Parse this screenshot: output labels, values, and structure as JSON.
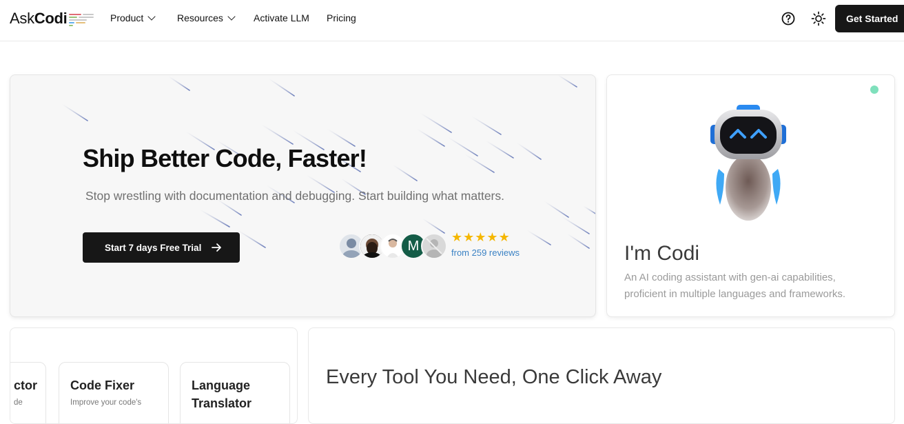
{
  "brand": {
    "ask": "Ask",
    "codi": "Codi"
  },
  "nav": {
    "items": [
      {
        "label": "Product",
        "dropdown": true
      },
      {
        "label": "Resources",
        "dropdown": true
      },
      {
        "label": "Activate LLM",
        "dropdown": false
      },
      {
        "label": "Pricing",
        "dropdown": false
      }
    ],
    "help_icon": "question-circle-icon",
    "theme_icon": "sun-icon",
    "cta": "Get Started"
  },
  "hero": {
    "title": "Ship Better Code, Faster!",
    "subtitle": "Stop wrestling with documentation and debugging. Start building what matters.",
    "cta": "Start 7 days Free Trial",
    "avatar_letter": "M",
    "rating": 5,
    "reviews": "from 259 reviews"
  },
  "codi": {
    "title": "I'm Codi",
    "description": "An AI coding assistant with gen-ai capabilities, proficient in multiple languages and frameworks."
  },
  "tools": {
    "items": [
      {
        "title": "ctor",
        "desc": "de"
      },
      {
        "title": "Code Fixer",
        "desc": "Improve your code's"
      },
      {
        "title": "Language Translator",
        "desc": ""
      }
    ]
  },
  "section": {
    "title": "Every Tool You Need, One Click Away"
  },
  "colors": {
    "accent": "#171717",
    "star": "#f5b700",
    "link": "#3b82c4",
    "status": "#7fe0bc"
  }
}
